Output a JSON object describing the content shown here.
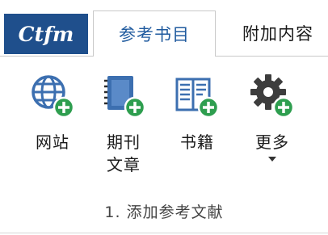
{
  "logo": {
    "text": "Ctfm",
    "bg_color": "#1f4f8c"
  },
  "tabs": [
    {
      "label": "参考书目",
      "active": true
    },
    {
      "label": "附加内容",
      "active": false
    }
  ],
  "ribbon": {
    "group_label": "1. 添加参考文献",
    "buttons": [
      {
        "icon": "globe-add-icon",
        "line1": "网站",
        "line2": ""
      },
      {
        "icon": "journal-add-icon",
        "line1": "期刊",
        "line2": "文章"
      },
      {
        "icon": "book-add-icon",
        "line1": "书籍",
        "line2": ""
      },
      {
        "icon": "gear-add-icon",
        "line1": "更多",
        "line2": "",
        "has_dropdown": true
      }
    ]
  },
  "colors": {
    "accent_blue": "#1f5a9e",
    "icon_blue": "#3c6fb0",
    "add_badge_green": "#2e9e4f",
    "gear_dark": "#3d3d3d"
  }
}
